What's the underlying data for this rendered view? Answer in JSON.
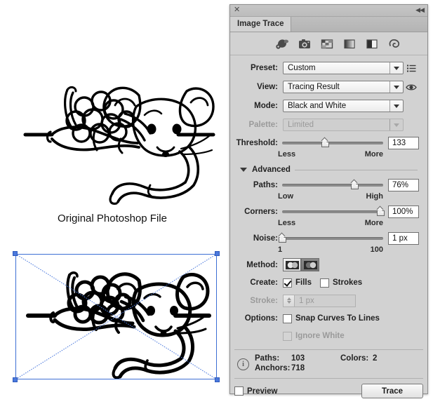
{
  "panel": {
    "window_title": "Image Trace",
    "close_glyph": "✕",
    "collapse_glyph": "◀◀",
    "tab_label": "Image Trace",
    "toolbar_icons": [
      {
        "name": "auto-color-icon",
        "title": "Auto-Color"
      },
      {
        "name": "high-color-icon",
        "title": "High Color"
      },
      {
        "name": "low-color-icon",
        "title": "Low Color"
      },
      {
        "name": "grayscale-icon",
        "title": "Grayscale"
      },
      {
        "name": "black-and-white-icon",
        "title": "Black and White"
      },
      {
        "name": "outline-icon",
        "title": "Outline"
      }
    ],
    "preset": {
      "label": "Preset:",
      "value": "Custom",
      "menu_icon": "preset-menu-icon"
    },
    "view": {
      "label": "View:",
      "value": "Tracing Result",
      "eye_icon": "eye-icon"
    },
    "mode": {
      "label": "Mode:",
      "value": "Black and White"
    },
    "palette": {
      "label": "Palette:",
      "value": "Limited",
      "disabled": true
    },
    "threshold": {
      "label": "Threshold:",
      "value": "133",
      "min_label": "Less",
      "max_label": "More",
      "percent": 43
    },
    "advanced": {
      "label": "Advanced",
      "expanded": true
    },
    "paths": {
      "label": "Paths:",
      "value": "76%",
      "min_label": "Low",
      "max_label": "High",
      "percent": 72
    },
    "corners": {
      "label": "Corners:",
      "value": "100%",
      "min_label": "Less",
      "max_label": "More",
      "percent": 98
    },
    "noise": {
      "label": "Noise:",
      "value": "1 px",
      "min_label": "1",
      "max_label": "100",
      "percent": 2
    },
    "method": {
      "label": "Method:",
      "buttons": [
        {
          "name": "method-abutting-button",
          "selected": false
        },
        {
          "name": "method-overlapping-button",
          "selected": true
        }
      ]
    },
    "create": {
      "label": "Create:",
      "fills": {
        "label": "Fills",
        "checked": true
      },
      "strokes": {
        "label": "Strokes",
        "checked": false
      }
    },
    "stroke": {
      "label": "Stroke:",
      "value": "1 px",
      "disabled": true
    },
    "options": {
      "label": "Options:",
      "snap_curves": {
        "label": "Snap Curves To Lines",
        "checked": false
      },
      "ignore_white": {
        "label": "Ignore White",
        "checked": false,
        "disabled": true
      }
    },
    "info": {
      "icon": "info-icon",
      "paths_label": "Paths:",
      "paths_value": "103",
      "colors_label": "Colors:",
      "colors_value": "2",
      "anchors_label": "Anchors:",
      "anchors_value": "718"
    },
    "footer": {
      "preview": {
        "label": "Preview",
        "checked": false
      },
      "trace_button": "Trace"
    }
  },
  "artboard": {
    "top_artwork_name": "mouse-balloon-line-art-original",
    "caption": "Original Photoshop File",
    "bottom_artwork_name": "mouse-balloon-line-art-traced",
    "selection": {
      "handles": 4,
      "color": "#4b79dd"
    }
  },
  "colors": {
    "panel_bg": "#d2d2d2",
    "panel_border": "#8e8e8e",
    "selection_blue": "#4b79dd",
    "field_bg": "#ffffff",
    "disabled_text": "#9a9a9a",
    "track": "#8a8a8a"
  }
}
